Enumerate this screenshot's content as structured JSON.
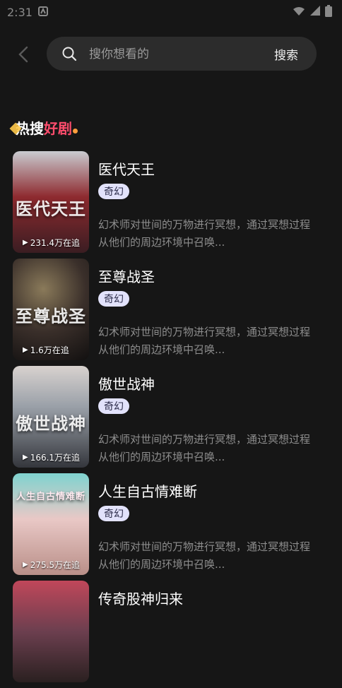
{
  "status": {
    "time": "2:31"
  },
  "search": {
    "placeholder": "搜你想看的",
    "button": "搜索"
  },
  "section": {
    "title_white": "热搜",
    "title_pink": "好剧"
  },
  "dramas": [
    {
      "title": "医代天王",
      "tag": "奇幻",
      "views": "231.4万在追",
      "poster_title": "医代天王",
      "desc1": "幻术师对世间的万物进行冥想，通过冥想过程",
      "desc2": "从他们的周边环境中召唤..."
    },
    {
      "title": "至尊战圣",
      "tag": "奇幻",
      "views": "1.6万在追",
      "poster_title": "至尊战圣",
      "desc1": "幻术师对世间的万物进行冥想，通过冥想过程",
      "desc2": "从他们的周边环境中召唤..."
    },
    {
      "title": "傲世战神",
      "tag": "奇幻",
      "views": "166.1万在追",
      "poster_title": "傲世战神",
      "desc1": "幻术师对世间的万物进行冥想，通过冥想过程",
      "desc2": "从他们的周边环境中召唤..."
    },
    {
      "title": "人生自古情难断",
      "tag": "奇幻",
      "views": "275.5万在追",
      "poster_title": "人生自古情难断",
      "desc1": "幻术师对世间的万物进行冥想，通过冥想过程",
      "desc2": "从他们的周边环境中召唤..."
    },
    {
      "title": "传奇股神归来",
      "tag": "",
      "views": "",
      "poster_title": "",
      "desc1": "",
      "desc2": ""
    }
  ]
}
